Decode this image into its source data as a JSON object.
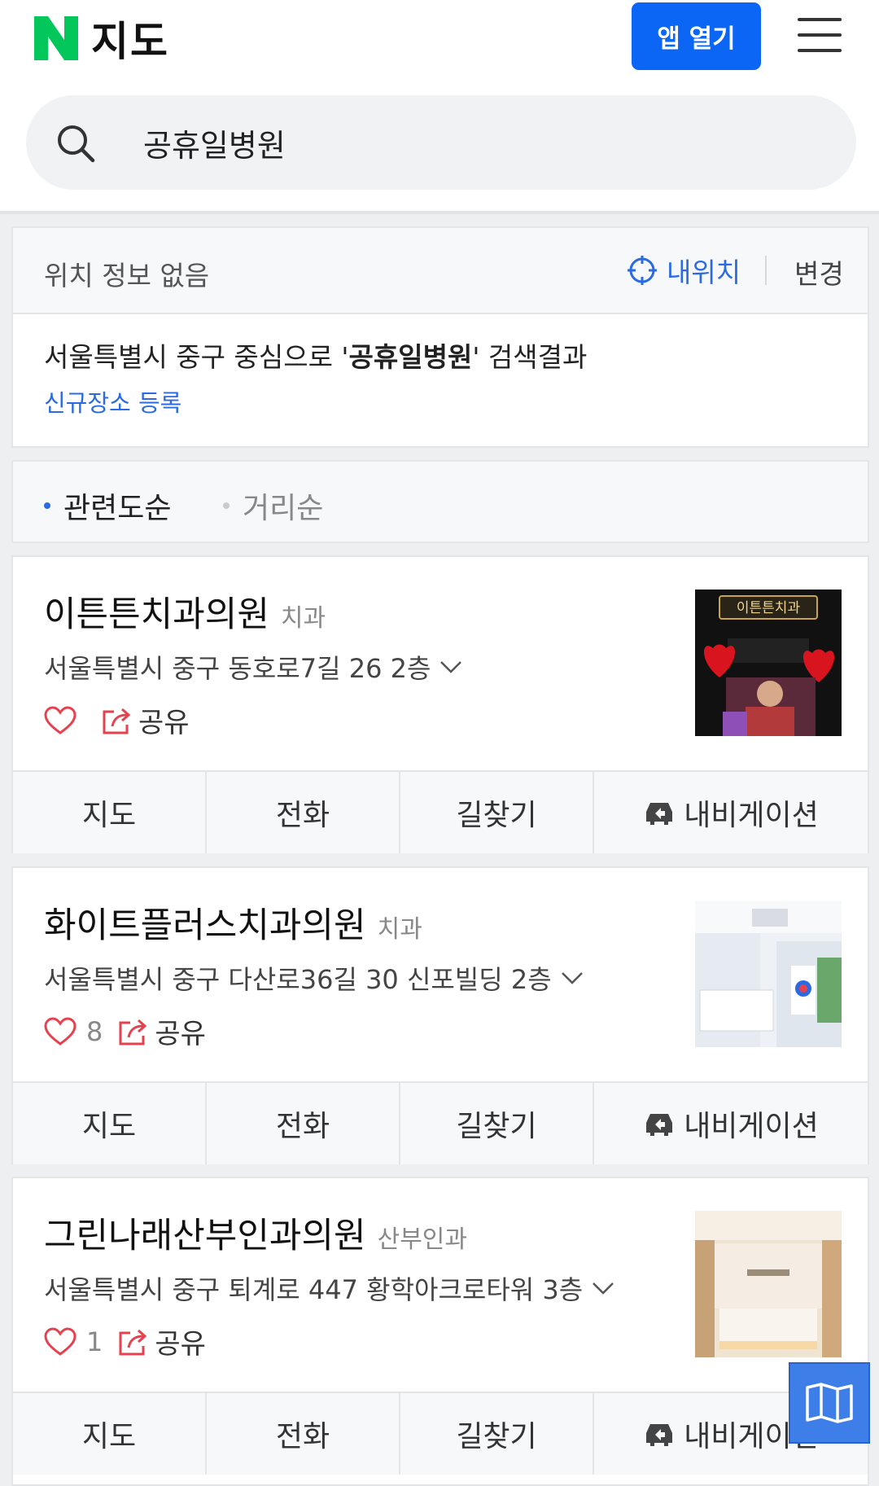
{
  "header": {
    "logo_letter": "N",
    "logo_text": "지도",
    "open_app_label": "앱 열기",
    "brand_green": "#03c75a",
    "accent_blue": "#0b66f5"
  },
  "search": {
    "value": "공휴일병원",
    "icon": "search-icon"
  },
  "location": {
    "status": "위치 정보 없음",
    "my_location_label": "내위치",
    "change_label": "변경",
    "result_prefix": "서울특별시 중구 중심으로 '",
    "result_query": "공휴일병원",
    "result_suffix": "' 검색결과",
    "register_link": "신규장소 등록"
  },
  "sort": {
    "options": [
      "관련도순",
      "거리순"
    ],
    "active": "관련도순"
  },
  "places": [
    {
      "name": "이튼튼치과의원",
      "category": "치과",
      "address": "서울특별시 중구 동호로7길 26 2층",
      "likes": "",
      "share_label": "공유",
      "buttons": [
        "지도",
        "전화",
        "길찾기",
        "내비게이션"
      ],
      "thumb_text": "이튼튼치과"
    },
    {
      "name": "화이트플러스치과의원",
      "category": "치과",
      "address": "서울특별시 중구 다산로36길 30 신포빌딩 2층",
      "likes": "8",
      "share_label": "공유",
      "buttons": [
        "지도",
        "전화",
        "길찾기",
        "내비게이션"
      ]
    },
    {
      "name": "그린나래산부인과의원",
      "category": "산부인과",
      "address": "서울특별시 중구 퇴계로 447 황학아크로타워 3층",
      "likes": "1",
      "share_label": "공유",
      "buttons": [
        "지도",
        "전화",
        "길찾기",
        "내비게이션"
      ]
    }
  ],
  "floating": {
    "icon": "map-icon"
  }
}
